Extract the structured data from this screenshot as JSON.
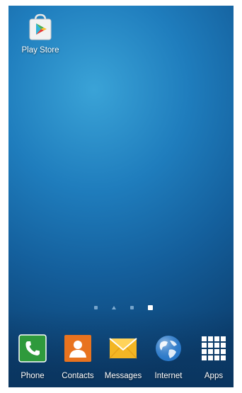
{
  "home_apps": [
    {
      "label": "Play Store",
      "icon": "play-store-icon"
    }
  ],
  "pager": {
    "pages": 4,
    "active_index": 3,
    "home_index": 1
  },
  "dock": [
    {
      "label": "Phone",
      "icon": "phone-icon",
      "color": "#2f9a3c"
    },
    {
      "label": "Contacts",
      "icon": "contacts-icon",
      "color": "#e8731f"
    },
    {
      "label": "Messages",
      "icon": "messages-icon",
      "color": "#f3b624"
    },
    {
      "label": "Internet",
      "icon": "globe-icon",
      "color": "#2a78c8"
    },
    {
      "label": "Apps",
      "icon": "apps-grid-icon",
      "color": "#ffffff"
    }
  ]
}
